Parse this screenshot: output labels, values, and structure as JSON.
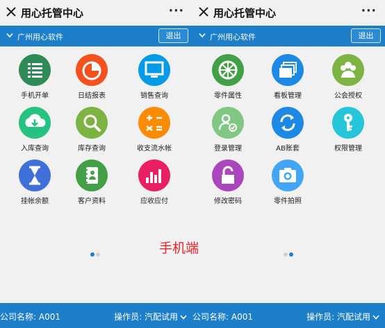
{
  "screens": [
    {
      "title": "用心托管中心",
      "more": "···",
      "company_label": "广州用心软件",
      "exit_label": "退出",
      "items": [
        {
          "label": "手机开单",
          "icon": "checklist-icon",
          "color": "#2e8b57"
        },
        {
          "label": "日结报表",
          "icon": "pie-chart-icon",
          "color": "#f4511e"
        },
        {
          "label": "销售查询",
          "icon": "monitor-icon",
          "color": "#039be5"
        },
        {
          "label": "入库查询",
          "icon": "cloud-download-icon",
          "color": "#26c281"
        },
        {
          "label": "库存查询",
          "icon": "magnifier-icon",
          "color": "#7cb342"
        },
        {
          "label": "收支流水帐",
          "icon": "calculator-icon",
          "color": "#fb8c00"
        },
        {
          "label": "挂帐余额",
          "icon": "hourglass-icon",
          "color": "#3f6fd8"
        },
        {
          "label": "客户资料",
          "icon": "address-book-icon",
          "color": "#43a047"
        },
        {
          "label": "应收应付",
          "icon": "bar-chart-icon",
          "color": "#e91e63"
        }
      ],
      "footer_company": "公司名称: A001",
      "footer_operator": "操作员: 汽配试用"
    },
    {
      "title": "用心托管中心",
      "more": "···",
      "company_label": "广州用心软件",
      "exit_label": "退出",
      "items": [
        {
          "label": "零件属性",
          "icon": "wheel-icon",
          "color": "#43a047"
        },
        {
          "label": "看板管理",
          "icon": "layers-icon",
          "color": "#1e88e5"
        },
        {
          "label": "公会授权",
          "icon": "users-icon",
          "color": "#7cb342"
        },
        {
          "label": "登录管理",
          "icon": "user-check-icon",
          "color": "#81c784"
        },
        {
          "label": "AB账套",
          "icon": "sync-icon",
          "color": "#1e88e5"
        },
        {
          "label": "权限管理",
          "icon": "key-icon",
          "color": "#26c6da"
        },
        {
          "label": "修改密码",
          "icon": "lock-icon",
          "color": "#ab47bc"
        },
        {
          "label": "零件拍照",
          "icon": "camera-icon",
          "color": "#42a5f5"
        }
      ],
      "footer_company": "公司名称: A001",
      "footer_operator": "操作员: 汽配试用"
    }
  ],
  "watermark": "手机端",
  "colors": {
    "accent": "#1d7ec9",
    "background": "#f1f1f1"
  }
}
